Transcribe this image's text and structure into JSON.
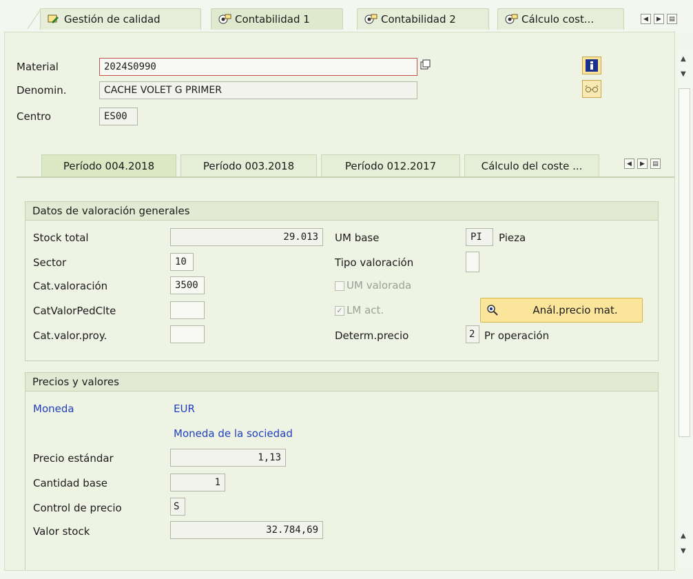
{
  "top_tabs": [
    {
      "label": "Gestión de calidad"
    },
    {
      "label": "Contabilidad 1"
    },
    {
      "label": "Contabilidad 2"
    },
    {
      "label": "Cálculo cost..."
    }
  ],
  "header": {
    "material_label": "Material",
    "material_value": "2024S0990",
    "denom_label": "Denomin.",
    "denom_value": "CACHE VOLET G PRIMER",
    "centro_label": "Centro",
    "centro_value": "ES00"
  },
  "period_tabs": [
    {
      "label": "Período 004.2018"
    },
    {
      "label": "Período 003.2018"
    },
    {
      "label": "Período 012.2017"
    },
    {
      "label": "Cálculo del coste ..."
    }
  ],
  "general": {
    "title": "Datos de valoración generales",
    "stock_total_label": "Stock total",
    "stock_total_value": "29.013",
    "sector_label": "Sector",
    "sector_value": "10",
    "cat_val_label": "Cat.valoración",
    "cat_val_value": "3500",
    "catvalorped_label": "CatValorPedClte",
    "catvalorped_value": "",
    "catvalorproy_label": "Cat.valor.proy.",
    "catvalorproy_value": "",
    "um_base_label": "UM base",
    "um_base_code": "PI",
    "um_base_text": "Pieza",
    "tipo_val_label": "Tipo valoración",
    "tipo_val_value": "",
    "um_valorada_label": "UM valorada",
    "lm_act_label": "LM act.",
    "anal_button_label": "Anál.precio mat.",
    "determ_label": "Determ.precio",
    "determ_code": "2",
    "determ_text": "Pr operación"
  },
  "prices": {
    "title": "Precios y valores",
    "moneda_label": "Moneda",
    "moneda_value": "EUR",
    "moneda_sociedad": "Moneda de la sociedad",
    "precio_std_label": "Precio estándar",
    "precio_std_value": "1,13",
    "cant_base_label": "Cantidad base",
    "cant_base_value": "1",
    "control_label": "Control de precio",
    "control_value": "S",
    "valor_stock_label": "Valor stock",
    "valor_stock_value": "32.784,69"
  },
  "colors": {
    "background": "#eef3e4",
    "accent_blue": "#1f3fbf",
    "button_yellow": "#fbe59a"
  }
}
